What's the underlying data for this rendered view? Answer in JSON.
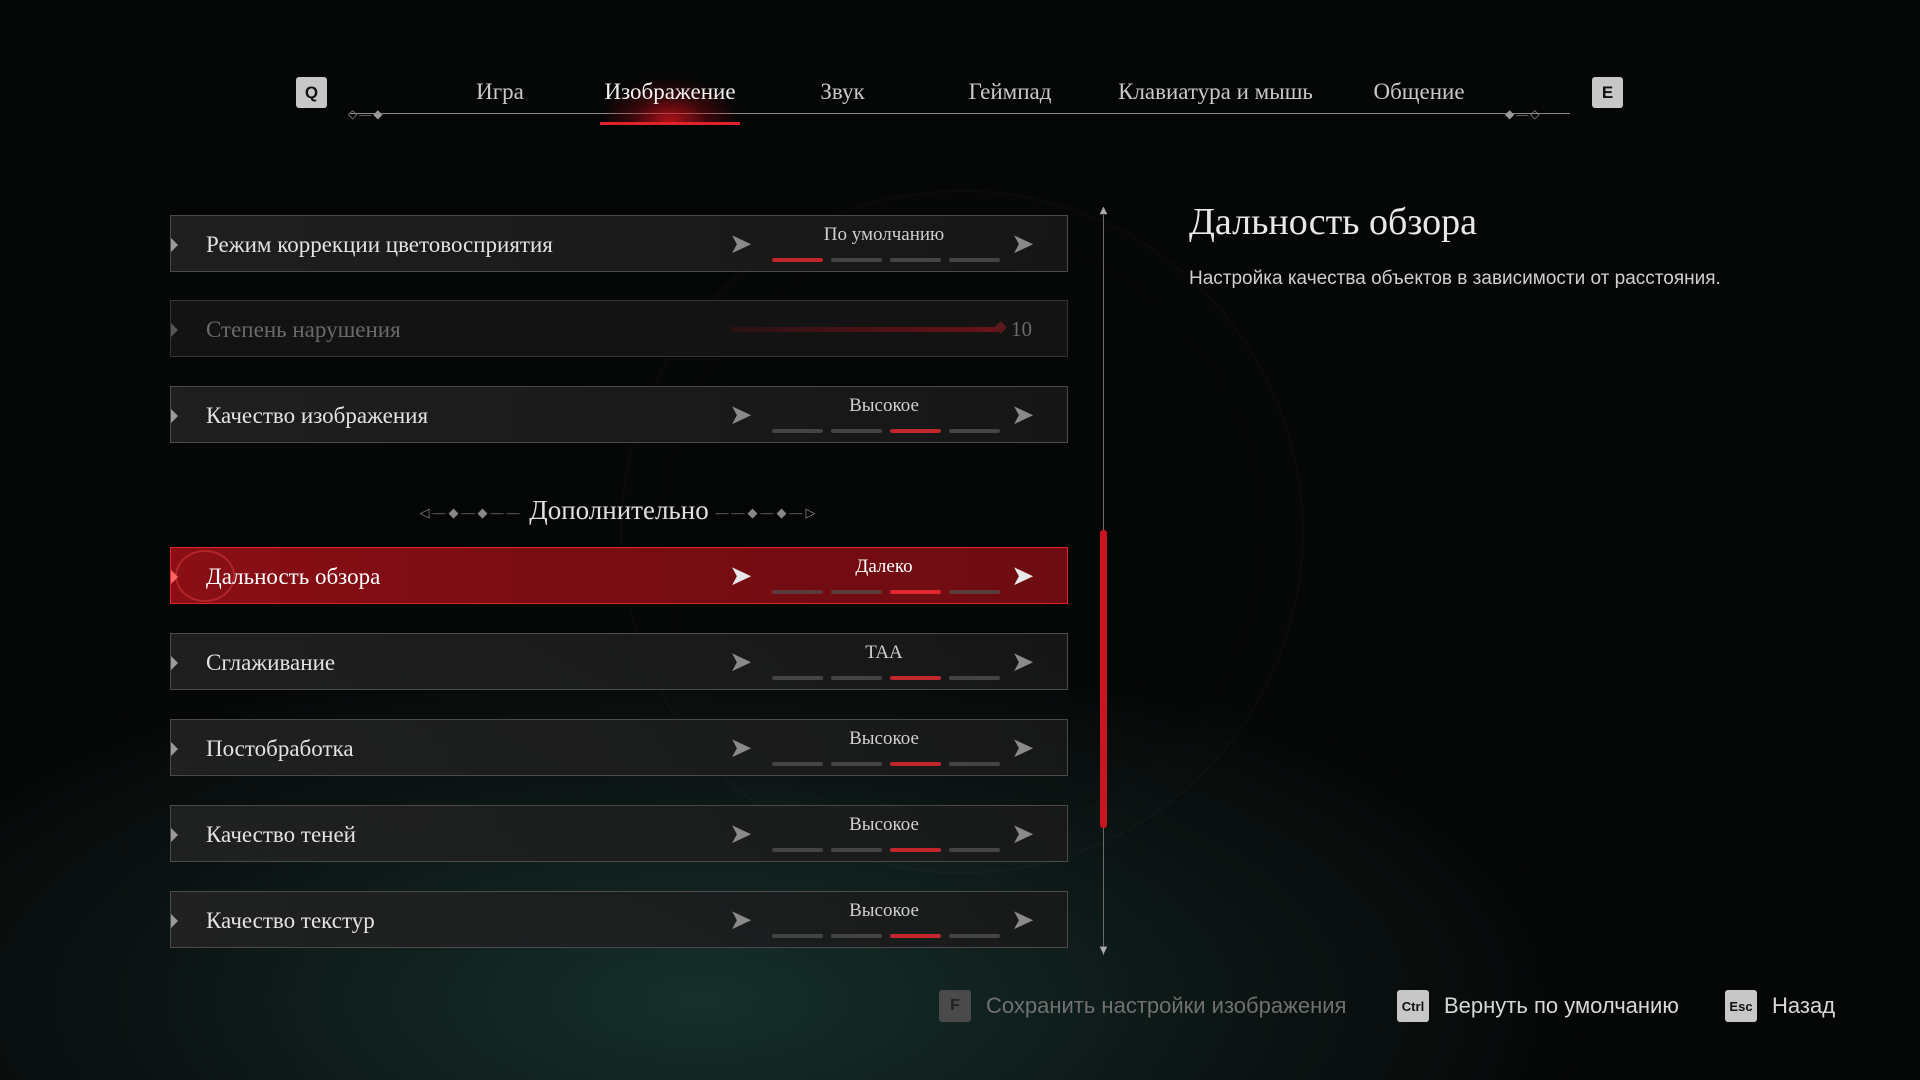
{
  "nav": {
    "prev_key": "Q",
    "next_key": "E",
    "tabs": [
      "Игра",
      "Изображение",
      "Звук",
      "Геймпад",
      "Клавиатура и мышь",
      "Общение"
    ],
    "active_tab": "Изображение"
  },
  "settings": {
    "color_correction": {
      "label": "Режим коррекции цветовосприятия",
      "value": "По умолчанию",
      "level": 1,
      "levels": 4
    },
    "impairment": {
      "label": "Степень нарушения",
      "value": "10",
      "disabled": true
    },
    "image_quality": {
      "label": "Качество изображения",
      "value": "Высокое",
      "level": 3,
      "levels": 4
    },
    "section_title": "Дополнительно",
    "view_distance": {
      "label": "Дальность обзора",
      "value": "Далеко",
      "level": 3,
      "levels": 4,
      "selected": true
    },
    "antialiasing": {
      "label": "Сглаживание",
      "value": "TAA",
      "level": 3,
      "levels": 4
    },
    "post_processing": {
      "label": "Постобработка",
      "value": "Высокое",
      "level": 3,
      "levels": 4
    },
    "shadow_quality": {
      "label": "Качество теней",
      "value": "Высокое",
      "level": 3,
      "levels": 4
    },
    "texture_quality": {
      "label": "Качество текстур",
      "value": "Высокое",
      "level": 3,
      "levels": 4
    }
  },
  "description": {
    "title": "Дальность обзора",
    "text": "Настройка качества объектов в зависимости от расстояния."
  },
  "footer": {
    "save": {
      "key": "F",
      "label": "Сохранить настройки изображения",
      "enabled": false
    },
    "reset": {
      "key": "Ctrl",
      "label": "Вернуть по умолчанию"
    },
    "back": {
      "key": "Esc",
      "label": "Назад"
    }
  },
  "colors": {
    "accent": "#c8161e",
    "selected_row": "#7a0d13"
  },
  "icons": {
    "row_marker": "triangle-right-icon",
    "arrow_left": "arrow-left-icon",
    "arrow_right": "arrow-right-icon"
  }
}
